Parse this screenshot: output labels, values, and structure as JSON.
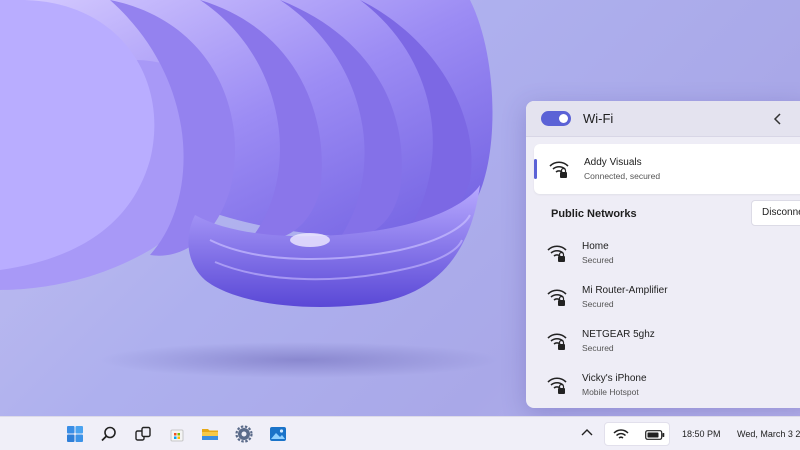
{
  "wifi_panel": {
    "title": "Wi-Fi",
    "toggle_state": "on",
    "connected_network": {
      "name": "Addy Visuals",
      "status": "Connected, secured"
    },
    "disconnect_label": "Disconnect",
    "section_title": "Public Networks",
    "networks": [
      {
        "name": "Home",
        "status": "Secured"
      },
      {
        "name": "Mi Router-Amplifier",
        "status": "Secured"
      },
      {
        "name": "NETGEAR 5ghz",
        "status": "Secured"
      },
      {
        "name": "Vicky's iPhone",
        "status": "Mobile Hotspot"
      }
    ]
  },
  "taskbar": {
    "apps": [
      "start-icon",
      "search-icon",
      "task-view-icon",
      "store-icon",
      "file-explorer-icon",
      "settings-icon",
      "photos-icon"
    ],
    "tray_icons": [
      "chevron-up-icon",
      "wifi-icon",
      "battery-icon"
    ],
    "time": "18:50 PM",
    "date": "Wed, March 3 2"
  },
  "colors": {
    "accent": "#5b62d6",
    "wallpaper_main": "#8b7ff0",
    "panel_bg": "#eeedf6"
  }
}
